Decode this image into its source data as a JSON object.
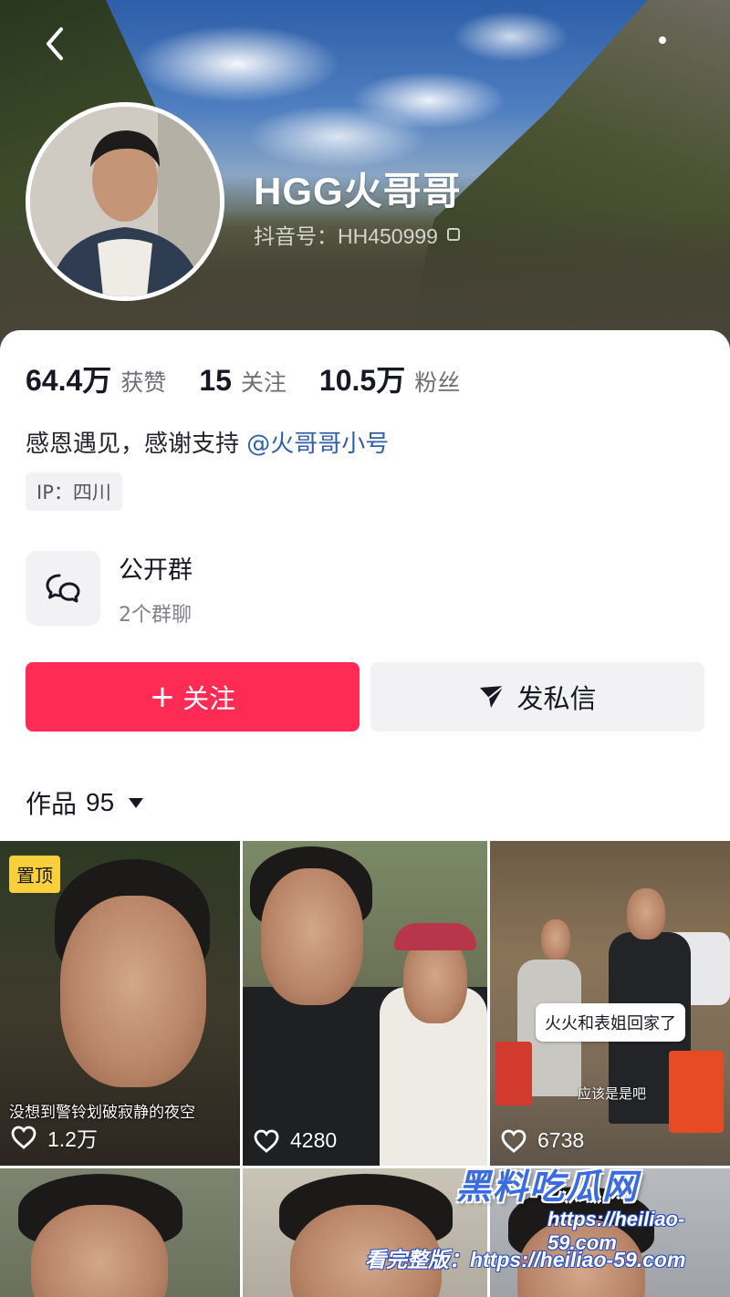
{
  "profile": {
    "nickname": "HGG火哥哥",
    "douyin_id": "抖音号：HH450999"
  },
  "stats": [
    {
      "value": "64.4万",
      "label": "获赞"
    },
    {
      "value": "15",
      "label": "关注"
    },
    {
      "value": "10.5万",
      "label": "粉丝"
    }
  ],
  "bio": {
    "text": "感恩遇见，感谢支持",
    "mention": "@火哥哥小号"
  },
  "ip": "IP：四川",
  "group": {
    "title": "公开群",
    "subtitle": "2个群聊"
  },
  "actions": {
    "follow_label": "关注",
    "follow_plus": "+",
    "message_label": "发私信"
  },
  "works": {
    "label": "作品",
    "count": "95"
  },
  "videos": [
    {
      "likes": "1.2万",
      "pinned": "置顶",
      "caption": "没想到警铃划破寂静的夜空"
    },
    {
      "likes": "4280"
    },
    {
      "likes": "6738",
      "bubble": "火火和表姐回家了",
      "subtitle": "应该是是吧"
    },
    {
      "likes": ""
    },
    {
      "likes": ""
    },
    {
      "likes": ""
    }
  ],
  "watermark": {
    "title": "黑料吃瓜网",
    "url": "https://heiliao-59.com",
    "line": "看完整版：https://heiliao-59.com"
  },
  "colors": {
    "accent": "#fe2c55",
    "mention": "#2f5fa8",
    "pin_badge": "#facf3c"
  }
}
